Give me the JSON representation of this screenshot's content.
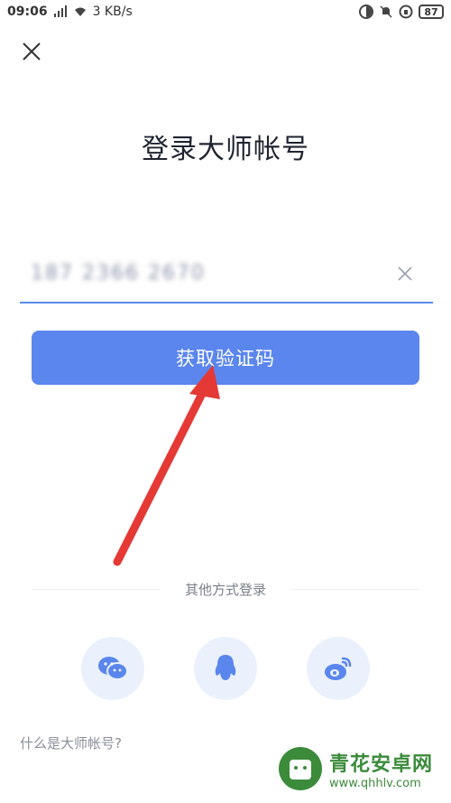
{
  "status_bar": {
    "time": "09:06",
    "network": "3 KB/s",
    "battery": "87"
  },
  "page": {
    "title": "登录大师帐号"
  },
  "phone_input": {
    "value": "187 2366 2670"
  },
  "primary_button": {
    "label": "获取验证码"
  },
  "other_login": {
    "label": "其他方式登录",
    "providers": [
      "wechat-icon",
      "qq-icon",
      "weibo-icon"
    ]
  },
  "footer": {
    "link": "什么是大师帐号?"
  },
  "watermark": {
    "name": "青花安卓网",
    "url": "www.qhhlv.com"
  },
  "colors": {
    "accent": "#5a86ed",
    "social_bg": "#eaf1fd",
    "arrow": "#e53935"
  }
}
